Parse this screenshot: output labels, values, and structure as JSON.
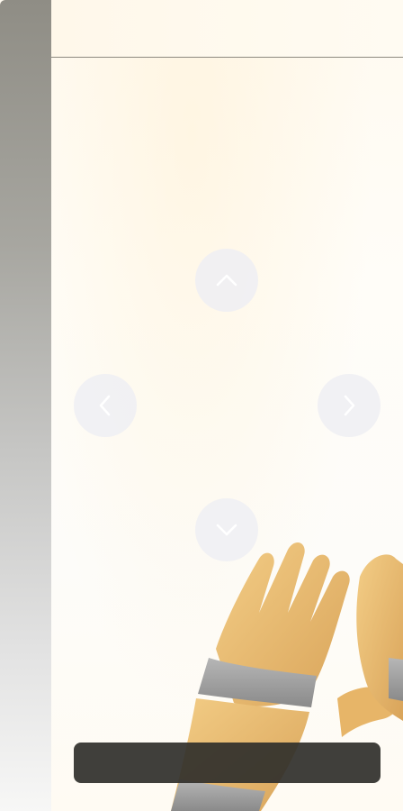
{
  "app": {
    "caption": ""
  },
  "controls": {
    "up": "chevron-up-icon",
    "down": "chevron-down-icon",
    "left": "chevron-left-icon",
    "right": "chevron-right-icon"
  },
  "colors": {
    "background": "#fffbf3",
    "sidebar_top": "#8f8d85",
    "sidebar_bottom": "#f7f7f6",
    "topbar_border": "#8e8a80",
    "arrow_button": "#eeeef3",
    "arrow_glyph": "#ffffff",
    "caption_bar": "#32302c",
    "hand_skin": "#e8b868",
    "wrist_tape": "#9a9a9a"
  }
}
